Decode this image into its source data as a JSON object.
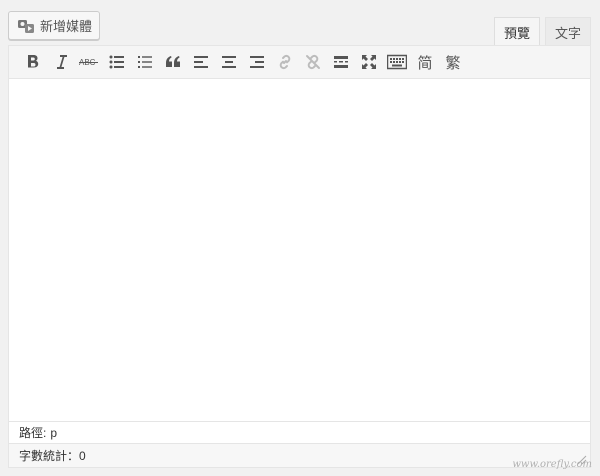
{
  "media": {
    "add_label": "新增媒體",
    "icon": "media-camera-icon"
  },
  "tabs": [
    {
      "label": "預覽",
      "active": true
    },
    {
      "label": "文字",
      "active": false
    }
  ],
  "toolbar": {
    "buttons": [
      {
        "name": "bold",
        "icon": "bold-icon"
      },
      {
        "name": "italic",
        "icon": "italic-icon"
      },
      {
        "name": "strikethrough",
        "icon": "strikethrough-icon"
      },
      {
        "name": "bullet-list",
        "icon": "bullet-list-icon"
      },
      {
        "name": "numbered-list",
        "icon": "numbered-list-icon"
      },
      {
        "name": "blockquote",
        "icon": "quote-icon"
      },
      {
        "name": "align-left",
        "icon": "align-left-icon"
      },
      {
        "name": "align-center",
        "icon": "align-center-icon"
      },
      {
        "name": "align-right",
        "icon": "align-right-icon"
      },
      {
        "name": "link",
        "icon": "link-icon"
      },
      {
        "name": "unlink",
        "icon": "unlink-icon"
      },
      {
        "name": "read-more",
        "icon": "read-more-icon"
      },
      {
        "name": "fullscreen",
        "icon": "fullscreen-icon"
      },
      {
        "name": "toolbar-toggle",
        "icon": "keyboard-icon"
      }
    ],
    "simplified_label": "简",
    "traditional_label": "繁"
  },
  "status": {
    "path_label": "路徑:",
    "path_value": "p",
    "word_count_label": "字數統計：",
    "word_count_value": "0"
  },
  "watermark": "www.orefly.com",
  "colors": {
    "background": "#f1f1f1",
    "toolbar": "#f5f5f5",
    "border": "#e5e5e5",
    "icon": "#555555"
  }
}
